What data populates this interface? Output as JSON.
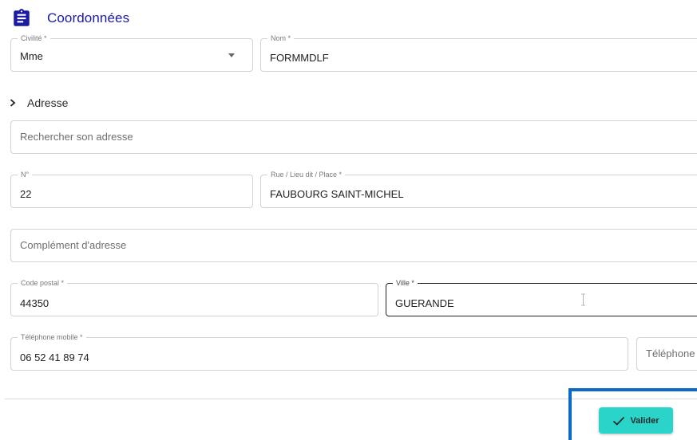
{
  "header": {
    "title": "Coordonnées",
    "icon": "clipboard-icon"
  },
  "fields": {
    "civilite": {
      "label": "Civilité *",
      "value": "Mme"
    },
    "nom": {
      "label": "Nom *",
      "value": "FORMMDLF"
    },
    "search": {
      "placeholder": "Rechercher son adresse"
    },
    "numero": {
      "label": "N°",
      "value": "22"
    },
    "rue": {
      "label": "Rue / Lieu dit / Place *",
      "value": "FAUBOURG SAINT-MICHEL"
    },
    "complement": {
      "placeholder": "Complément d'adresse"
    },
    "code_postal": {
      "label": "Code postal *",
      "value": "44350"
    },
    "ville": {
      "label": "Ville *",
      "value": "GUERANDE"
    },
    "mobile": {
      "label": "Téléphone mobile *",
      "value": "06 52 41 89 74"
    },
    "telephone": {
      "placeholder": "Téléphone"
    }
  },
  "address_section": {
    "title": "Adresse"
  },
  "actions": {
    "validate_label": "Valider"
  },
  "colors": {
    "title": "#1a1aa6",
    "button": "#2ad4c9",
    "highlight": "#0b69c7"
  }
}
